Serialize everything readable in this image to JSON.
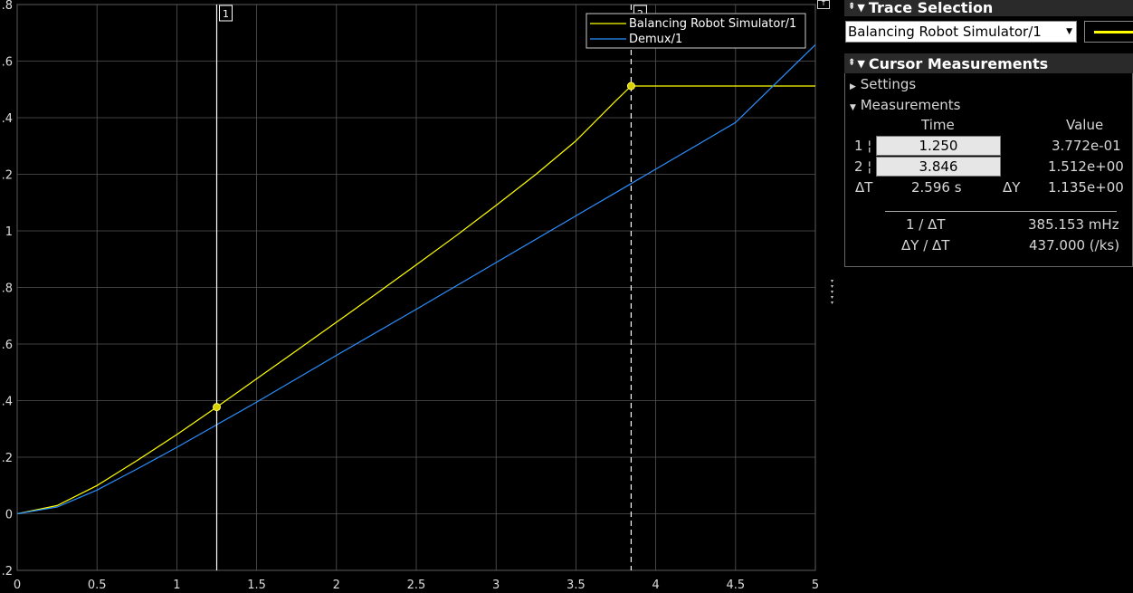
{
  "chart_data": {
    "type": "line",
    "xlim": [
      0,
      5
    ],
    "ylim": [
      -0.2,
      1.8
    ],
    "x_ticks": [
      "0",
      "0.5",
      "1",
      "1.5",
      "2",
      "2.5",
      "3",
      "3.5",
      "4",
      "4.5",
      "5"
    ],
    "y_ticks": [
      ".2",
      "0",
      ".2",
      ".4",
      ".6",
      ".8",
      "1",
      ".2",
      ".4",
      ".6",
      ".8"
    ],
    "y_tick_values": [
      -0.2,
      0,
      0.2,
      0.4,
      0.6,
      0.8,
      1.0,
      1.2,
      1.4,
      1.6,
      1.8
    ],
    "grid": true,
    "legend_position": "top-right",
    "series": [
      {
        "name": "Balancing Robot Simulator/1",
        "color": "#ffff00",
        "x": [
          0,
          0.25,
          0.5,
          0.75,
          1.0,
          1.25,
          1.5,
          1.75,
          2.0,
          2.25,
          2.5,
          2.75,
          3.0,
          3.25,
          3.5,
          3.75,
          3.846,
          4.0,
          4.5,
          5.0
        ],
        "y": [
          0,
          0.029,
          0.1,
          0.188,
          0.28,
          0.3772,
          0.477,
          0.577,
          0.677,
          0.778,
          0.88,
          0.983,
          1.09,
          1.2,
          1.318,
          1.46,
          1.512,
          1.512,
          1.512,
          1.512
        ]
      },
      {
        "name": "Demux/1",
        "color": "#2b8fff",
        "x": [
          0,
          0.25,
          0.5,
          0.75,
          1.0,
          1.25,
          1.5,
          2.0,
          2.5,
          3.0,
          3.5,
          3.846,
          4.0,
          4.5,
          5.0
        ],
        "y": [
          0,
          0.024,
          0.084,
          0.158,
          0.235,
          0.315,
          0.395,
          0.56,
          0.723,
          0.888,
          1.053,
          1.167,
          1.218,
          1.383,
          1.658
        ]
      }
    ],
    "cursors": [
      {
        "label": "1",
        "x": 1.25,
        "y": 0.3772,
        "style": "solid"
      },
      {
        "label": "2",
        "x": 3.846,
        "y": 1.512,
        "style": "dashed"
      }
    ]
  },
  "trace_selection": {
    "title": "Trace Selection",
    "selected": "Balancing Robot Simulator/1",
    "swatch_color": "#ffff00"
  },
  "cursor_measurements": {
    "title": "Cursor Measurements",
    "settings_label": "Settings",
    "measurements_label": "Measurements",
    "col_time": "Time",
    "col_value": "Value",
    "rows": [
      {
        "label": "1 ¦",
        "time": "1.250",
        "value": "3.772e-01"
      },
      {
        "label": "2 ¦",
        "time": "3.846",
        "value": "1.512e+00"
      }
    ],
    "delta_t_label": "ΔT",
    "delta_t": "2.596 s",
    "delta_y_label": "ΔY",
    "delta_y": "1.135e+00",
    "inv_dt_label": "1 / ΔT",
    "inv_dt": "385.153 mHz",
    "slope_label": "ΔY / ΔT",
    "slope": "437.000 (/ks)"
  }
}
